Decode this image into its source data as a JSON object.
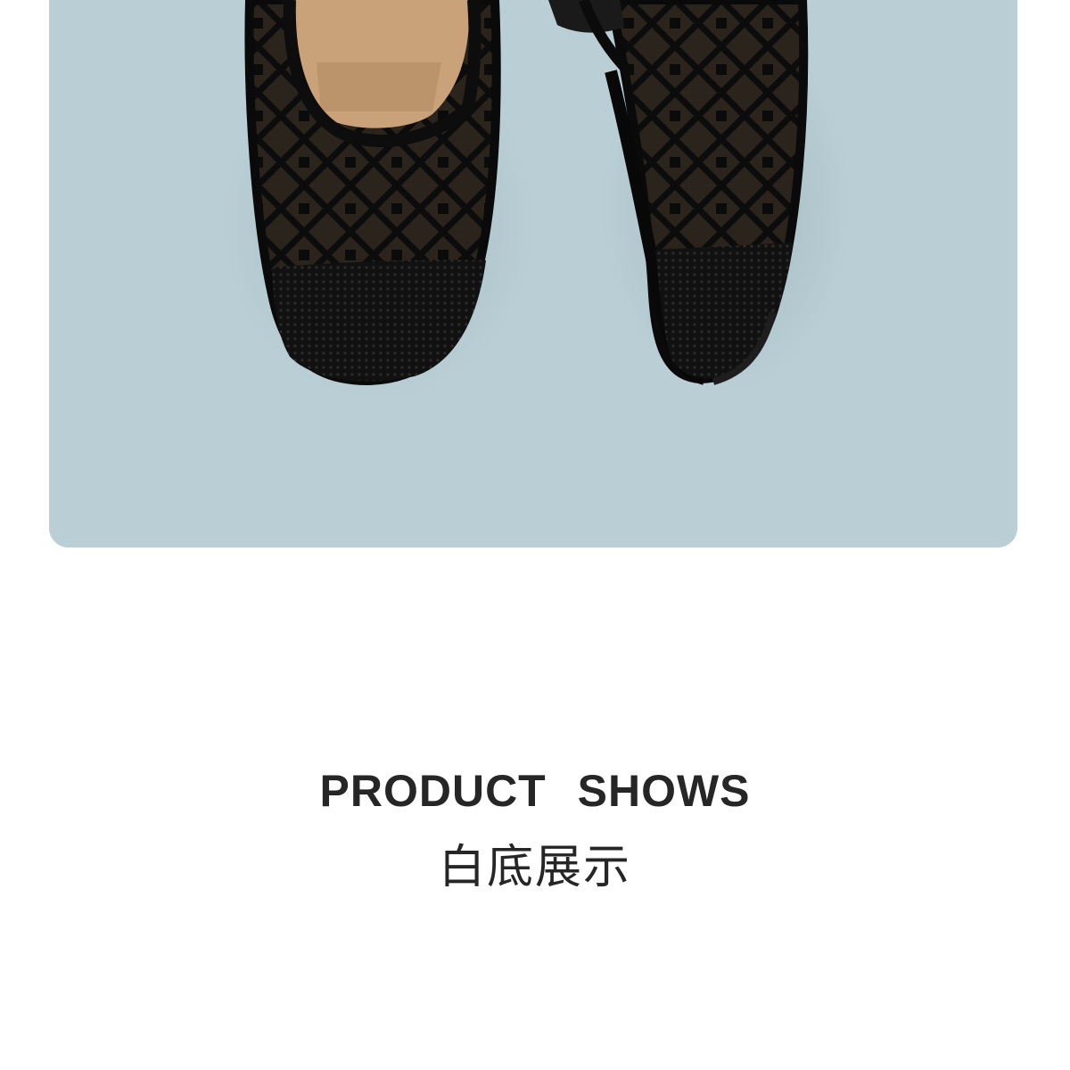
{
  "photo": {
    "subject": "black mesh rhinestone flat shoes on light blue background",
    "background_color": "#b9cfd5",
    "shoe_color": "#141414"
  },
  "section": {
    "title_en": "PRODUCT  SHOWS",
    "title_zh": "白底展示"
  }
}
